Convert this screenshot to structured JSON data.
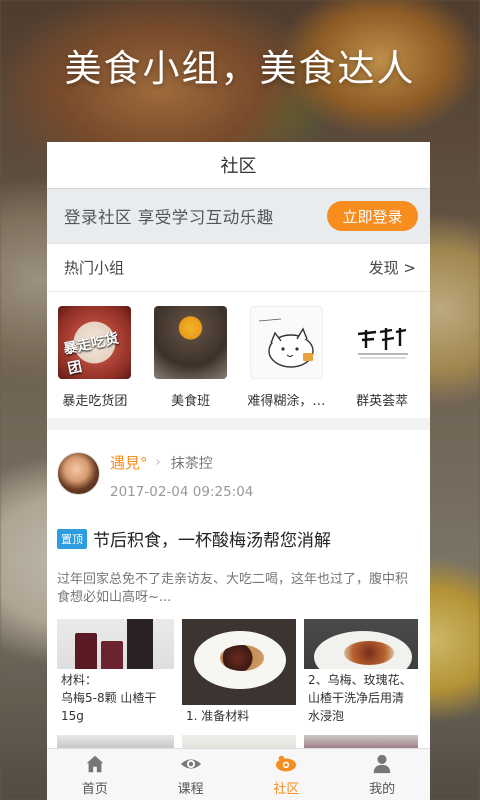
{
  "hero": {
    "title": "美食小组，美食达人"
  },
  "header": {
    "title": "社区"
  },
  "login": {
    "prompt": "登录社区 享受学习互动乐趣",
    "button": "立即登录"
  },
  "groups": {
    "title": "热门小组",
    "discover": "发现 >",
    "items": [
      {
        "name": "暴走吃货团",
        "thumb_text": "暴走吃货团"
      },
      {
        "name": "美食班"
      },
      {
        "name": "难得糊涂，…"
      },
      {
        "name": "群英荟萃"
      }
    ]
  },
  "post": {
    "author": "遇見°",
    "group": "抹茶控",
    "timestamp": "2017-02-04 09:25:04",
    "pin_label": "置顶",
    "title": "节后积食，一杯酸梅汤帮您消解",
    "excerpt": "过年回家总免不了走亲访友、大吃二喝，这年也过了，腹中积食想必如山高呀~...",
    "captions": [
      "材料：\n乌梅5-8颗 山楂干15g",
      "1. 准备材料",
      "2、乌梅、玫瑰花、山楂干洗净后用清水浸泡"
    ]
  },
  "tabbar": {
    "items": [
      {
        "label": "首页",
        "icon": "home-icon"
      },
      {
        "label": "课程",
        "icon": "eye-icon"
      },
      {
        "label": "社区",
        "icon": "community-icon",
        "active": true
      },
      {
        "label": "我的",
        "icon": "profile-icon"
      }
    ]
  },
  "colors": {
    "accent": "#f78d1e",
    "pin": "#2d9de0"
  }
}
